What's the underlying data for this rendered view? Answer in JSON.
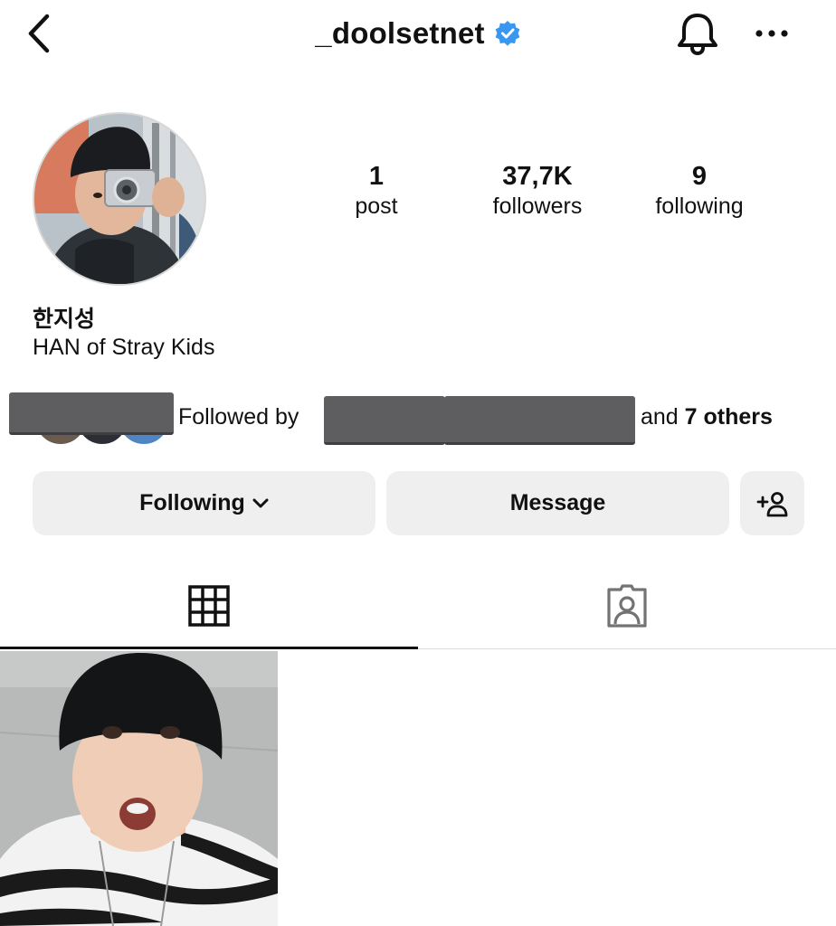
{
  "header": {
    "username": "_doolsetnet",
    "back_icon": "chevron-left-icon",
    "verified_icon": "verified-badge-icon",
    "bell_icon": "bell-icon",
    "more_icon": "more-horizontal-icon"
  },
  "stats": [
    {
      "value": "1",
      "label": "post"
    },
    {
      "value": "37,7K",
      "label": "followers"
    },
    {
      "value": "9",
      "label": "following"
    }
  ],
  "profile": {
    "display_name": "한지성",
    "bio": "HAN of Stray Kids"
  },
  "followed_by": {
    "prefix": "Followed by",
    "and_text": "and",
    "others": "7 others"
  },
  "actions": {
    "following_label": "Following",
    "message_label": "Message",
    "add_user_icon": "add-user-icon"
  },
  "tabs": [
    {
      "name": "posts",
      "icon": "grid-icon",
      "active": true
    },
    {
      "name": "tagged",
      "icon": "tagged-person-icon",
      "active": false
    }
  ],
  "colors": {
    "verified_blue": "#3897f0",
    "button_bg": "#efefef",
    "redaction": "#5e5e60"
  }
}
